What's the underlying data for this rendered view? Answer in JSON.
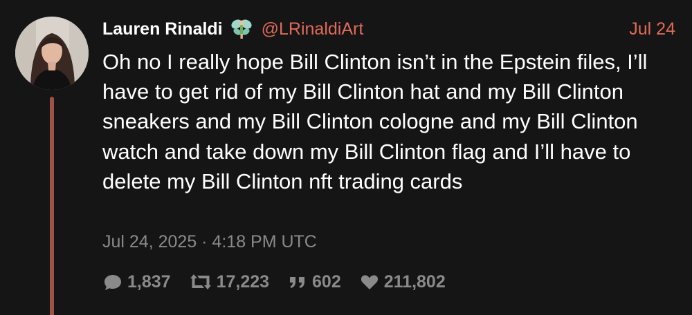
{
  "tweet": {
    "author_name": "Lauren Rinaldi",
    "author_emoji_icon": "fairy-icon",
    "handle": "@LRinaldiArt",
    "date_short": "Jul 24",
    "text": "Oh no I really hope Bill Clinton isn’t in the Epstein files, I’ll have to get rid of my Bill Clinton hat and my Bill Clinton sneakers and my Bill Clinton cologne and my Bill Clinton watch and take down my Bill Clinton flag and I’ll have to delete my Bill Clinton nft trading cards",
    "timestamp": "Jul 24, 2025 · 4:18 PM UTC",
    "stats": {
      "comments": "1,837",
      "retweets": "17,223",
      "quotes": "602",
      "likes": "211,802"
    }
  },
  "colors": {
    "background": "#151515",
    "accent": "#e06a5a",
    "thread_line": "#9b5248",
    "muted": "#8a8a8a"
  }
}
